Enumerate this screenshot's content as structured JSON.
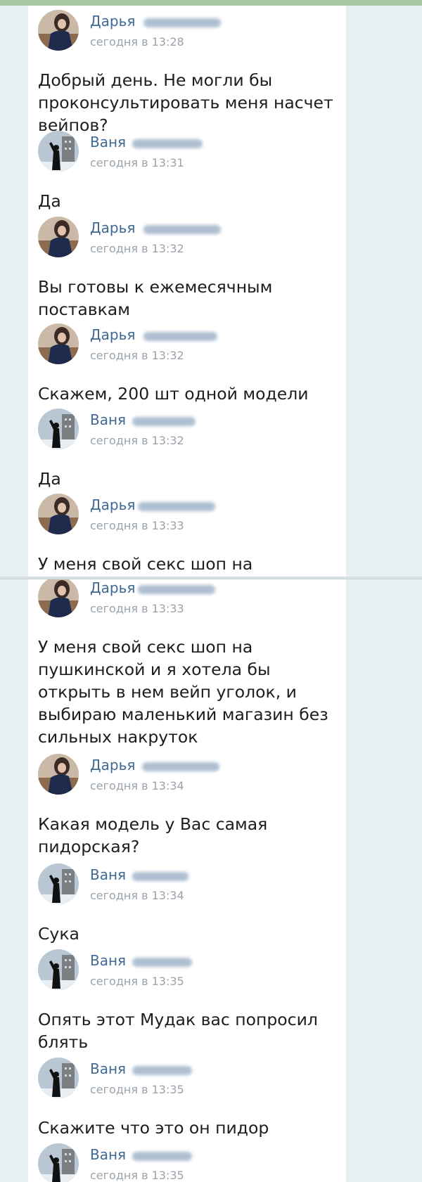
{
  "messages_top": [
    {
      "author": "Дарья",
      "avatar": "darya-avatar",
      "time": "сегодня в 13:28",
      "text": "Добрый день. Не могли бы проконсультировать меня насчет вейпов?"
    },
    {
      "author": "Ваня",
      "avatar": "vanya-avatar",
      "time": "сегодня в 13:31",
      "text": "Да"
    },
    {
      "author": "Дарья",
      "avatar": "darya-avatar",
      "time": "сегодня в 13:32",
      "text": "Вы готовы к ежемесячным поставкам"
    },
    {
      "author": "Дарья",
      "avatar": "darya-avatar",
      "time": "сегодня в 13:32",
      "text": "Скажем, 200 шт одной модели"
    },
    {
      "author": "Ваня",
      "avatar": "vanya-avatar",
      "time": "сегодня в 13:32",
      "text": "Да"
    },
    {
      "author": "Дарья",
      "avatar": "darya-avatar",
      "time": "сегодня в 13:33",
      "text": "У меня свой секс шоп на"
    }
  ],
  "messages_bottom": [
    {
      "author": "Дарья",
      "avatar": "darya-avatar",
      "time": "сегодня в 13:33",
      "text": "У меня свой секс шоп на пушкинской и я хотела бы открыть в нем вейп уголок, и выбираю маленький магазин без сильных накруток"
    },
    {
      "author": "Дарья",
      "avatar": "darya-avatar",
      "time": "сегодня в 13:34",
      "text": "Какая модель у Вас самая пидорская?"
    },
    {
      "author": "Ваня",
      "avatar": "vanya-avatar",
      "time": "сегодня в 13:34",
      "text": "Сука"
    },
    {
      "author": "Ваня",
      "avatar": "vanya-avatar",
      "time": "сегодня в 13:35",
      "text": "Опять этот Мудак вас попросил блять"
    },
    {
      "author": "Ваня",
      "avatar": "vanya-avatar",
      "time": "сегодня в 13:35",
      "text": "Скажите что это он пидор"
    },
    {
      "author": "Ваня",
      "avatar": "vanya-avatar",
      "time": "сегодня в 13:35",
      "text": ""
    }
  ],
  "colors": {
    "author_name": "#3f6a95",
    "timestamp": "#9aa3ab",
    "message_text": "#1d1d1d",
    "panel_bg": "#ffffff",
    "page_bg": "#e6eff1",
    "top_accent": "#a7c7a3"
  }
}
